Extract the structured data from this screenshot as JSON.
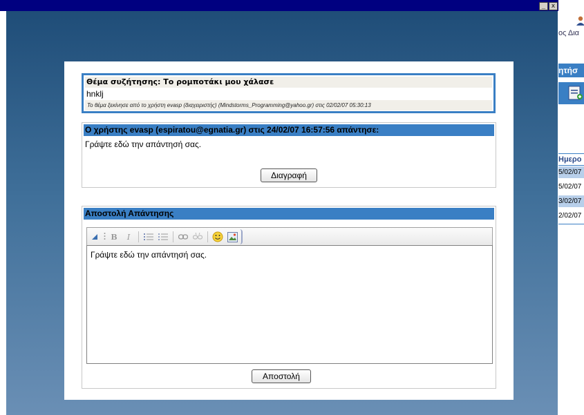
{
  "window": {
    "minimize_label": "_",
    "close_label": "x"
  },
  "topic": {
    "title": "Θέμα συζήτησης: Το ρομποτάκι μου χάλασε",
    "body": "hnklj",
    "meta": "Το θέμα ξεκίνησε από το χρήστη evasp (διαχειριστής) (Mindstorms_Programming@yahoo.gr) στις 02/02/07 05:30:13"
  },
  "reply": {
    "header": "Ο χρήστης evasp (espiratou@egnatia.gr) στις 24/02/07 16:57:56 απάντησε:",
    "text": "Γράψτε εδώ την απάντησή σας.",
    "delete_label": "Διαγραφή"
  },
  "send": {
    "header": "Αποστολή Απάντησης",
    "editor_text": "Γράψτε εδώ την απάντησή σας.",
    "send_label": "Αποστολή",
    "toolbar": {
      "bold": "B",
      "italic": "I"
    }
  },
  "side": {
    "user_text": "ος Δια",
    "section_text": "ητήσ",
    "column_header": "Ημερο",
    "dates": [
      "5/02/07",
      "5/02/07",
      "3/02/07",
      "2/02/07"
    ]
  },
  "colors": {
    "accent": "#3a7fc4",
    "titlebar": "#000080"
  }
}
